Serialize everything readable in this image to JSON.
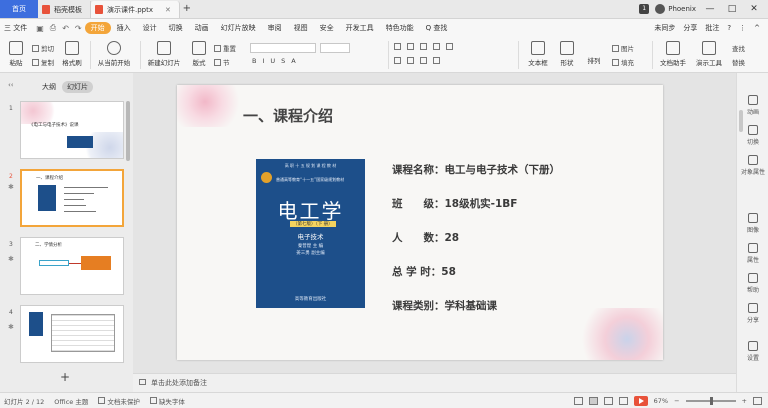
{
  "titlebar": {
    "home_tab": "首页",
    "tabs": [
      {
        "label": "稻壳模板",
        "icon_color": "#e8523a",
        "active": false
      },
      {
        "label": "演示课件.pptx",
        "icon_color": "#e8523a",
        "active": true
      }
    ],
    "plus": "+",
    "badge": "1",
    "user_name": "Phoenix",
    "window_controls": [
      "—",
      "□",
      "✕"
    ]
  },
  "menubar": {
    "file": "三 文件",
    "items": [
      "开始",
      "插入",
      "设计",
      "切换",
      "动画",
      "幻灯片放映",
      "审阅",
      "视图",
      "安全",
      "开发工具",
      "特色功能"
    ],
    "active": "开始",
    "search": "Q 查找",
    "right": [
      "未同步",
      "分享",
      "批注",
      "?",
      "⋮",
      "^"
    ]
  },
  "ribbon": {
    "paste": "粘贴",
    "cut": "剪切",
    "copy": "复制",
    "format_painter": "格式刷",
    "play_from_current": "从当前开始",
    "new_slide": "新建幻灯片",
    "layout": "版式",
    "section": "节",
    "reset": "重置",
    "textbox": "文本框",
    "shape": "形状",
    "arrange": "排列",
    "image": "图片",
    "fill": "填充",
    "doc_assistant": "文档助手",
    "show_tools": "演示工具",
    "find": "查找",
    "replace": "替换"
  },
  "leftpanel": {
    "tabs": [
      "大纲",
      "幻灯片"
    ],
    "active_tab": "幻灯片",
    "slides": [
      {
        "num": "1",
        "label": "《电工与电子技术》说课",
        "selected": false
      },
      {
        "num": "2",
        "label": "一、课程介绍",
        "selected": true
      },
      {
        "num": "3",
        "label": "二、学情分析",
        "selected": false
      },
      {
        "num": "4",
        "label": "",
        "selected": false
      }
    ],
    "add": "+"
  },
  "slide": {
    "title": "一、课程介绍",
    "book": {
      "top": "高 职 十 五 规 划 课 程 教 材",
      "subtitle": "普通高等教育“十一五”国家级规划教材",
      "title": "电工学",
      "edition": "（第七版）（下 册）",
      "sub": "电子技术",
      "authors": "秦曾煌  主  编",
      "authors2": "姜三勇  副主编",
      "publisher": "高等教育出版社"
    },
    "info": [
      "课程名称：电工与电子技术（下册）",
      "班　　级：18级机实-1BF",
      "人　　数：28",
      "总 学 时：58",
      "课程类别：学科基础课"
    ]
  },
  "rightbar": {
    "items": [
      "动画",
      "切换",
      "对象属性",
      "图像",
      "属性",
      "帮助",
      "分享",
      "设置"
    ]
  },
  "notes": {
    "placeholder": "单击此处添加备注"
  },
  "statusbar": {
    "slide_info": "幻灯片 2 / 12",
    "theme": "Office 主题",
    "doc_status": "文档未保护",
    "missing_font": "缺失字体",
    "zoom": "67%",
    "zoom_minus": "−",
    "zoom_plus": "+",
    "zoom_fraction": 0.5
  }
}
